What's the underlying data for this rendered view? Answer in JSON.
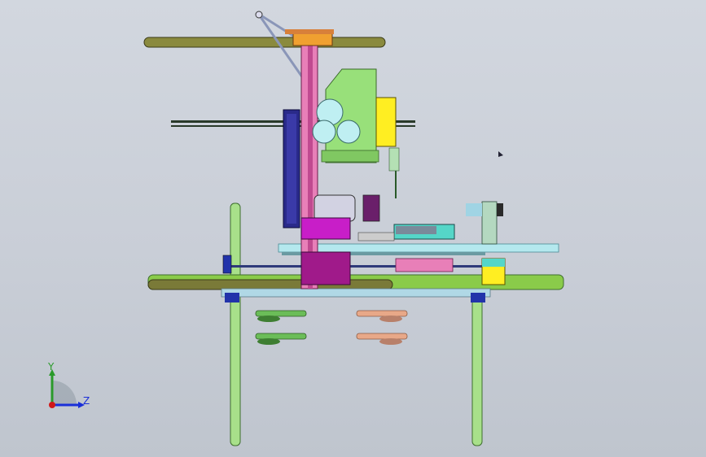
{
  "viewport": {
    "background_top": "#d2d7df",
    "background_bottom": "#bfc5ce"
  },
  "triad": {
    "y_label": "Y",
    "z_label": "Z",
    "y_color": "#2a9a2a",
    "z_color": "#1a2fd8",
    "origin_color": "#d01818"
  },
  "model": {
    "parts": [
      {
        "name": "frame-legs",
        "color": "#a8e08a"
      },
      {
        "name": "main-rails",
        "color": "#7fb83a"
      },
      {
        "name": "upper-guide-rail",
        "color": "#7a7a38"
      },
      {
        "name": "vertical-column",
        "color": "#e77fb2"
      },
      {
        "name": "spindle-head",
        "color": "#98e07a"
      },
      {
        "name": "yellow-motor-housing",
        "color": "#ffee22"
      },
      {
        "name": "blue-motor",
        "color": "#2a2a8a"
      },
      {
        "name": "cyan-carriage",
        "color": "#55d6c8"
      },
      {
        "name": "magenta-bracket",
        "color": "#c81ec8"
      },
      {
        "name": "orange-block",
        "color": "#f0a030"
      }
    ]
  }
}
